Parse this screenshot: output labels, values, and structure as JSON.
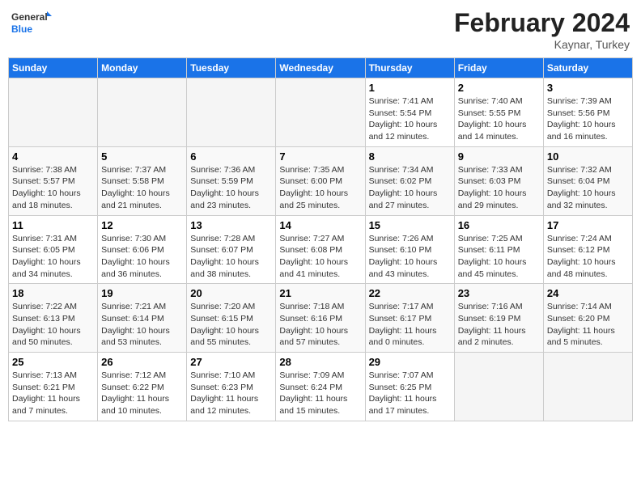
{
  "header": {
    "logo_line1": "General",
    "logo_line2": "Blue",
    "month": "February 2024",
    "location": "Kaynar, Turkey"
  },
  "weekdays": [
    "Sunday",
    "Monday",
    "Tuesday",
    "Wednesday",
    "Thursday",
    "Friday",
    "Saturday"
  ],
  "weeks": [
    [
      {
        "day": "",
        "info": ""
      },
      {
        "day": "",
        "info": ""
      },
      {
        "day": "",
        "info": ""
      },
      {
        "day": "",
        "info": ""
      },
      {
        "day": "1",
        "info": "Sunrise: 7:41 AM\nSunset: 5:54 PM\nDaylight: 10 hours\nand 12 minutes."
      },
      {
        "day": "2",
        "info": "Sunrise: 7:40 AM\nSunset: 5:55 PM\nDaylight: 10 hours\nand 14 minutes."
      },
      {
        "day": "3",
        "info": "Sunrise: 7:39 AM\nSunset: 5:56 PM\nDaylight: 10 hours\nand 16 minutes."
      }
    ],
    [
      {
        "day": "4",
        "info": "Sunrise: 7:38 AM\nSunset: 5:57 PM\nDaylight: 10 hours\nand 18 minutes."
      },
      {
        "day": "5",
        "info": "Sunrise: 7:37 AM\nSunset: 5:58 PM\nDaylight: 10 hours\nand 21 minutes."
      },
      {
        "day": "6",
        "info": "Sunrise: 7:36 AM\nSunset: 5:59 PM\nDaylight: 10 hours\nand 23 minutes."
      },
      {
        "day": "7",
        "info": "Sunrise: 7:35 AM\nSunset: 6:00 PM\nDaylight: 10 hours\nand 25 minutes."
      },
      {
        "day": "8",
        "info": "Sunrise: 7:34 AM\nSunset: 6:02 PM\nDaylight: 10 hours\nand 27 minutes."
      },
      {
        "day": "9",
        "info": "Sunrise: 7:33 AM\nSunset: 6:03 PM\nDaylight: 10 hours\nand 29 minutes."
      },
      {
        "day": "10",
        "info": "Sunrise: 7:32 AM\nSunset: 6:04 PM\nDaylight: 10 hours\nand 32 minutes."
      }
    ],
    [
      {
        "day": "11",
        "info": "Sunrise: 7:31 AM\nSunset: 6:05 PM\nDaylight: 10 hours\nand 34 minutes."
      },
      {
        "day": "12",
        "info": "Sunrise: 7:30 AM\nSunset: 6:06 PM\nDaylight: 10 hours\nand 36 minutes."
      },
      {
        "day": "13",
        "info": "Sunrise: 7:28 AM\nSunset: 6:07 PM\nDaylight: 10 hours\nand 38 minutes."
      },
      {
        "day": "14",
        "info": "Sunrise: 7:27 AM\nSunset: 6:08 PM\nDaylight: 10 hours\nand 41 minutes."
      },
      {
        "day": "15",
        "info": "Sunrise: 7:26 AM\nSunset: 6:10 PM\nDaylight: 10 hours\nand 43 minutes."
      },
      {
        "day": "16",
        "info": "Sunrise: 7:25 AM\nSunset: 6:11 PM\nDaylight: 10 hours\nand 45 minutes."
      },
      {
        "day": "17",
        "info": "Sunrise: 7:24 AM\nSunset: 6:12 PM\nDaylight: 10 hours\nand 48 minutes."
      }
    ],
    [
      {
        "day": "18",
        "info": "Sunrise: 7:22 AM\nSunset: 6:13 PM\nDaylight: 10 hours\nand 50 minutes."
      },
      {
        "day": "19",
        "info": "Sunrise: 7:21 AM\nSunset: 6:14 PM\nDaylight: 10 hours\nand 53 minutes."
      },
      {
        "day": "20",
        "info": "Sunrise: 7:20 AM\nSunset: 6:15 PM\nDaylight: 10 hours\nand 55 minutes."
      },
      {
        "day": "21",
        "info": "Sunrise: 7:18 AM\nSunset: 6:16 PM\nDaylight: 10 hours\nand 57 minutes."
      },
      {
        "day": "22",
        "info": "Sunrise: 7:17 AM\nSunset: 6:17 PM\nDaylight: 11 hours\nand 0 minutes."
      },
      {
        "day": "23",
        "info": "Sunrise: 7:16 AM\nSunset: 6:19 PM\nDaylight: 11 hours\nand 2 minutes."
      },
      {
        "day": "24",
        "info": "Sunrise: 7:14 AM\nSunset: 6:20 PM\nDaylight: 11 hours\nand 5 minutes."
      }
    ],
    [
      {
        "day": "25",
        "info": "Sunrise: 7:13 AM\nSunset: 6:21 PM\nDaylight: 11 hours\nand 7 minutes."
      },
      {
        "day": "26",
        "info": "Sunrise: 7:12 AM\nSunset: 6:22 PM\nDaylight: 11 hours\nand 10 minutes."
      },
      {
        "day": "27",
        "info": "Sunrise: 7:10 AM\nSunset: 6:23 PM\nDaylight: 11 hours\nand 12 minutes."
      },
      {
        "day": "28",
        "info": "Sunrise: 7:09 AM\nSunset: 6:24 PM\nDaylight: 11 hours\nand 15 minutes."
      },
      {
        "day": "29",
        "info": "Sunrise: 7:07 AM\nSunset: 6:25 PM\nDaylight: 11 hours\nand 17 minutes."
      },
      {
        "day": "",
        "info": ""
      },
      {
        "day": "",
        "info": ""
      }
    ]
  ]
}
